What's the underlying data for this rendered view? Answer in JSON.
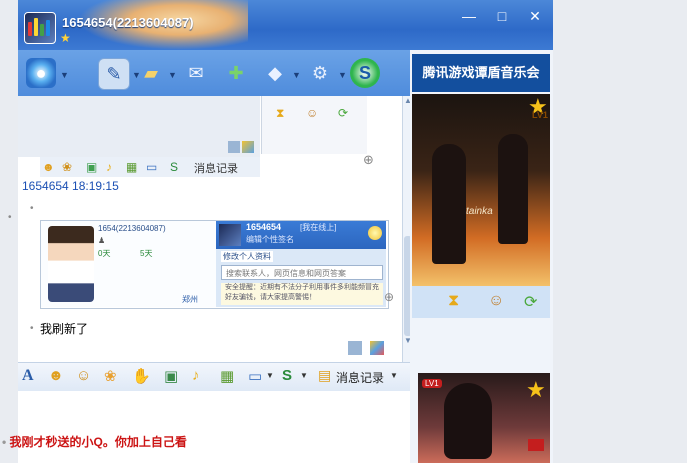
{
  "window": {
    "title": "1654654(2213604087)",
    "controls": {
      "minimize": "—",
      "maximize": "□",
      "close": "✕"
    }
  },
  "toolbar": {
    "items": [
      "video-icon",
      "mic-icon",
      "folder-icon",
      "mail-icon",
      "add-icon",
      "app-icon",
      "settings-icon",
      "s-app-icon"
    ]
  },
  "chat": {
    "toolbar_history_label": "消息记录",
    "message_meta": "1654654   18:19:15",
    "card": {
      "left_name": "1654(2213604087)",
      "stat_days_1": "0天",
      "stat_days_2": "5天",
      "right_name": "1654654",
      "right_status": "[我在线上]",
      "right_sign": "编辑个性签名",
      "right_button": "修改个人资料",
      "search_placeholder": "搜索联系人，网页信息和网页答案",
      "notice": "安全提醒：近期有不法分子利用事件多利能频冒充好友骗钱，请大家提高警惕！",
      "left_footer": "郑州"
    },
    "message_text": "我刷新了",
    "bottom_toolbar_history_label": "消息记录"
  },
  "ad": {
    "title": "腾讯游戏谭盾音乐会",
    "badge": "LV1",
    "overlay_text": "tainka",
    "badge2": "LV1"
  },
  "page": {
    "bottom_message": "我刚才秒送的小Q。你加上自己看"
  },
  "colors": {
    "title_bar": "#2e6ac8",
    "accent_red": "#cc1414",
    "meta_blue": "#1a4fb3"
  }
}
